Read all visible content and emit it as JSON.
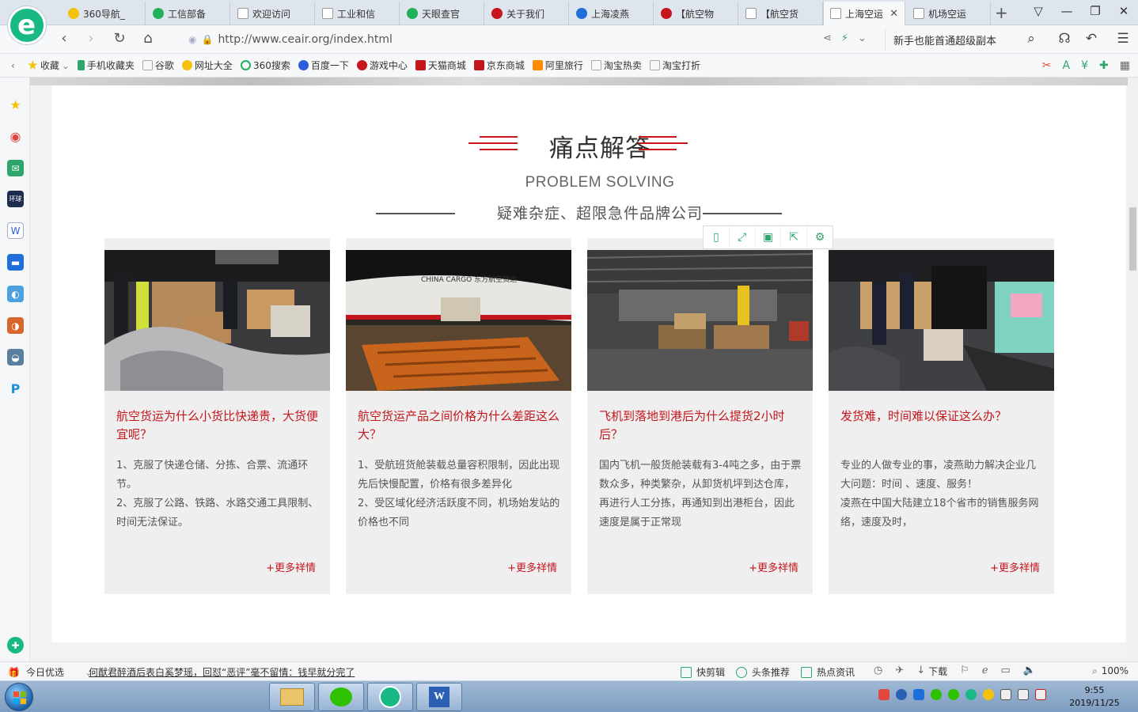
{
  "browser": {
    "tabs": [
      {
        "label": "360导航_",
        "color": "#f4c20d"
      },
      {
        "label": "工信部备",
        "color": "#20b15a"
      },
      {
        "label": "欢迎访问",
        "color": "#ffffff"
      },
      {
        "label": "工业和信",
        "color": "#ffffff"
      },
      {
        "label": "天眼查官",
        "color": "#20b15a"
      },
      {
        "label": "关于我们",
        "color": "#c4161c"
      },
      {
        "label": "上海凌燕",
        "color": "#1e6fd9"
      },
      {
        "label": "【航空物",
        "color": "#c4161c"
      },
      {
        "label": "【航空货",
        "color": "#ffffff"
      },
      {
        "label": "上海空运",
        "color": "#ffffff",
        "active": true
      },
      {
        "label": "机场空运",
        "color": "#ffffff"
      }
    ],
    "url": "http://www.ceair.org/index.html",
    "search_text": "新手也能首通超级副本",
    "bookmarks": [
      {
        "label": "收藏",
        "color": "#f4c20d"
      },
      {
        "label": "手机收藏夹",
        "color": "#2ea56a"
      },
      {
        "label": "谷歌",
        "color": "#bbbbbb"
      },
      {
        "label": "网址大全",
        "color": "#f4c20d"
      },
      {
        "label": "360搜索",
        "color": "#20b15a"
      },
      {
        "label": "百度一下",
        "color": "#2b5fd9"
      },
      {
        "label": "游戏中心",
        "color": "#c4161c"
      },
      {
        "label": "天猫商城",
        "color": "#c4161c"
      },
      {
        "label": "京东商城",
        "color": "#c4161c"
      },
      {
        "label": "阿里旅行",
        "color": "#ff8a00"
      },
      {
        "label": "淘宝热卖",
        "color": "#bbbbbb"
      },
      {
        "label": "淘宝打折",
        "color": "#bbbbbb"
      }
    ]
  },
  "section": {
    "title": "痛点解答",
    "title_en": "PROBLEM SOLVING",
    "subtitle": "疑难杂症、超限急件品牌公司"
  },
  "cards": [
    {
      "title": "航空货运为什么小货比快递贵，大货便宜呢？",
      "body": [
        "1、克服了快递仓储、分拣、合票、流通环节。",
        "2、克服了公路、铁路、水路交通工具限制、时间无法保证。"
      ],
      "more": "+更多祥情"
    },
    {
      "title": "航空货运产品之间价格为什么差距这么大？",
      "body": [
        "1、受航班货舱装载总量容积限制，因此出现先后快慢配置，价格有很多差异化",
        "2、受区域化经济活跃度不同，机场始发站的价格也不同"
      ],
      "more": "+更多祥情",
      "plane_text": "CHINA CARGO 东方航空货运"
    },
    {
      "title": "飞机到落地到港后为什么提货2小时后？",
      "body": [
        "国内飞机一般货舱装载有3-4吨之多，由于票数众多，种类繁杂，从卸货机坪到达仓库，再进行人工分拣，再通知到出港柜台，因此速度是属于正常现"
      ],
      "more": "+更多祥情"
    },
    {
      "title": "发货难，时间难以保证这么办？",
      "body": [
        "专业的人做专业的事，凌燕助力解决企业几大问题：时间 、速度、服务！",
        "凌燕在中国大陆建立18个省市的销售服务网络，速度及时，"
      ],
      "more": "+更多祥情"
    }
  ],
  "statusbar": {
    "left_label": "今日优选",
    "news": "何猷君醉酒后表白奚梦瑶，回怼“恶评”毫不留情：钱早就分完了",
    "items": [
      "快剪辑",
      "头条推荐",
      "热点资讯"
    ],
    "download": "下载",
    "zoom": "100%"
  },
  "taskbar": {
    "time": "9:55",
    "date": "2019/11/25"
  },
  "colors": {
    "accent_red": "#c4161c",
    "green": "#2ea56a"
  }
}
